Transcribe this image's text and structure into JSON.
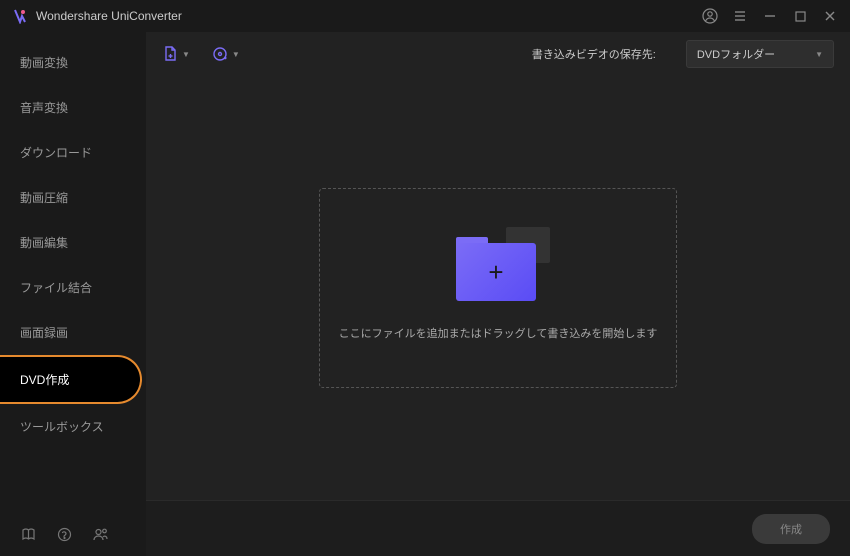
{
  "app": {
    "title": "Wondershare UniConverter"
  },
  "titlebar": {
    "account": "account",
    "menu": "menu",
    "minimize": "minimize",
    "maximize": "maximize",
    "close": "close"
  },
  "sidebar": {
    "items": [
      {
        "label": "動画変換"
      },
      {
        "label": "音声変換"
      },
      {
        "label": "ダウンロード"
      },
      {
        "label": "動画圧縮"
      },
      {
        "label": "動画編集"
      },
      {
        "label": "ファイル結合"
      },
      {
        "label": "画面録画"
      },
      {
        "label": "DVD作成",
        "active": true
      },
      {
        "label": "ツールボックス"
      }
    ],
    "bottom": {
      "guide": "guide",
      "help": "help",
      "user": "user"
    }
  },
  "toolbar": {
    "save_label": "書き込みビデオの保存先:",
    "save_destination": {
      "selected": "DVDフォルダー"
    }
  },
  "dropzone": {
    "text": "ここにファイルを追加またはドラッグして書き込みを開始します"
  },
  "footer": {
    "create_label": "作成"
  }
}
